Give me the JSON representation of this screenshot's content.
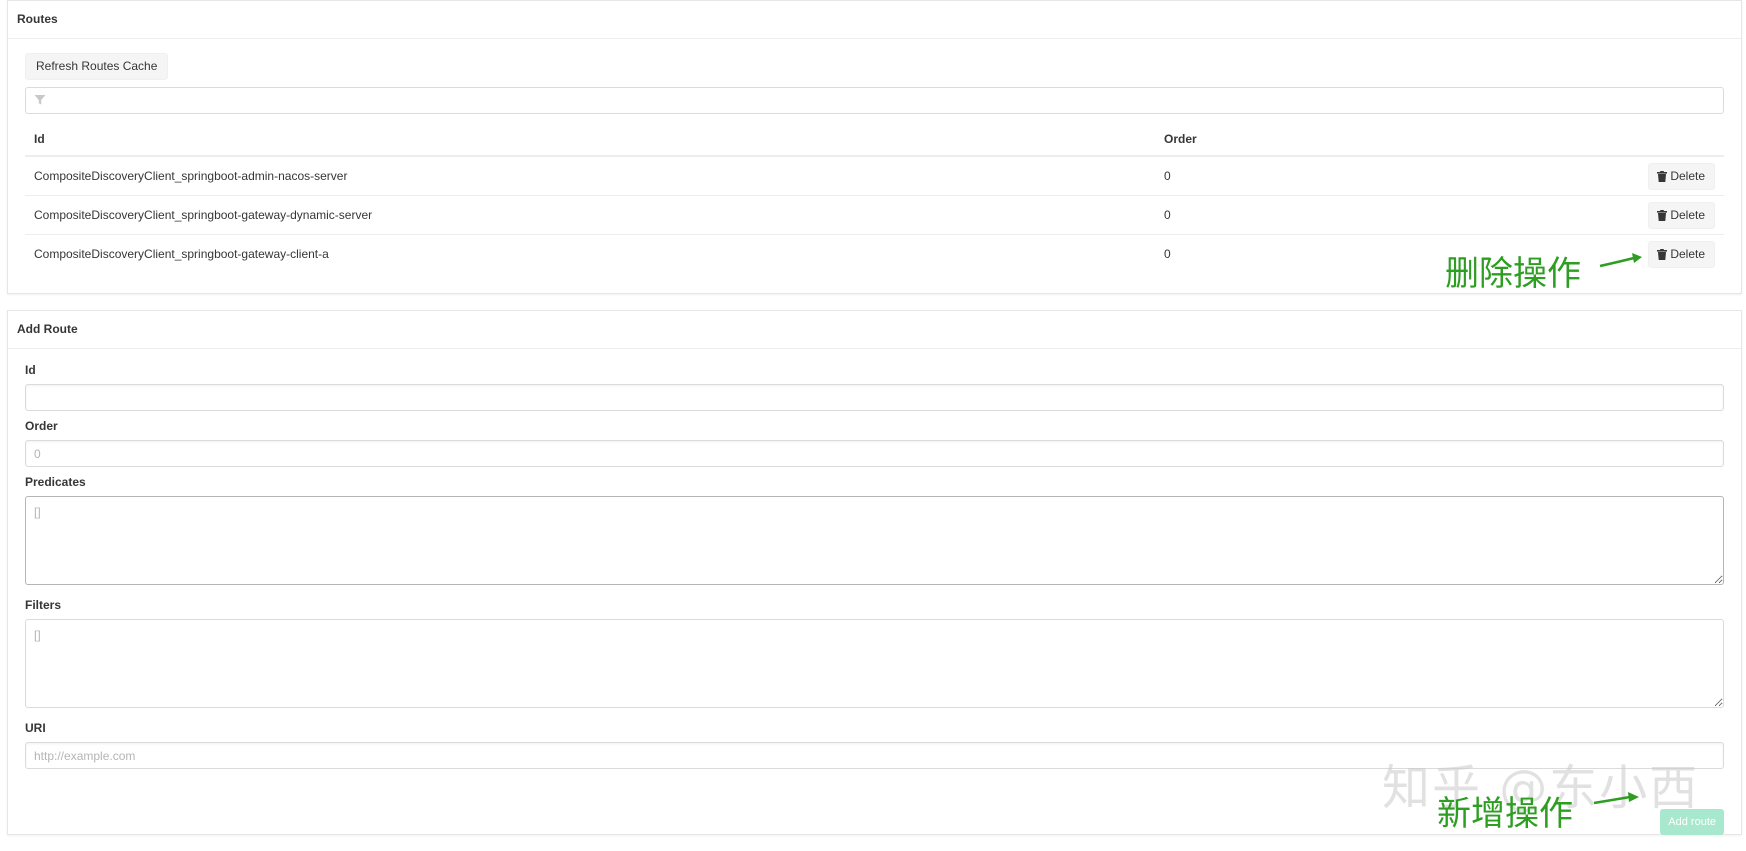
{
  "routes_panel": {
    "title": "Routes",
    "refresh_label": "Refresh Routes Cache",
    "filter": {
      "value": "",
      "placeholder": ""
    },
    "columns": {
      "id": "Id",
      "order": "Order"
    },
    "delete_label": "Delete",
    "rows": [
      {
        "id": "CompositeDiscoveryClient_springboot-admin-nacos-server",
        "order": "0"
      },
      {
        "id": "CompositeDiscoveryClient_springboot-gateway-dynamic-server",
        "order": "0"
      },
      {
        "id": "CompositeDiscoveryClient_springboot-gateway-client-a",
        "order": "0"
      }
    ]
  },
  "add_panel": {
    "title": "Add Route",
    "fields": {
      "id": {
        "label": "Id",
        "value": "",
        "placeholder": ""
      },
      "order": {
        "label": "Order",
        "value": "",
        "placeholder": "0"
      },
      "predicates": {
        "label": "Predicates",
        "value": "",
        "placeholder": "[]"
      },
      "filters": {
        "label": "Filters",
        "value": "",
        "placeholder": "[]"
      },
      "uri": {
        "label": "URI",
        "value": "",
        "placeholder": "http://example.com"
      }
    },
    "submit_label": "Add route"
  },
  "annotations": {
    "delete_note": "删除操作",
    "add_note": "新增操作"
  },
  "watermark": "知乎 @东小西",
  "colors": {
    "annotation": "#2e9e23",
    "add_button": "#a8e8cf",
    "border": "#dbdbdb"
  }
}
